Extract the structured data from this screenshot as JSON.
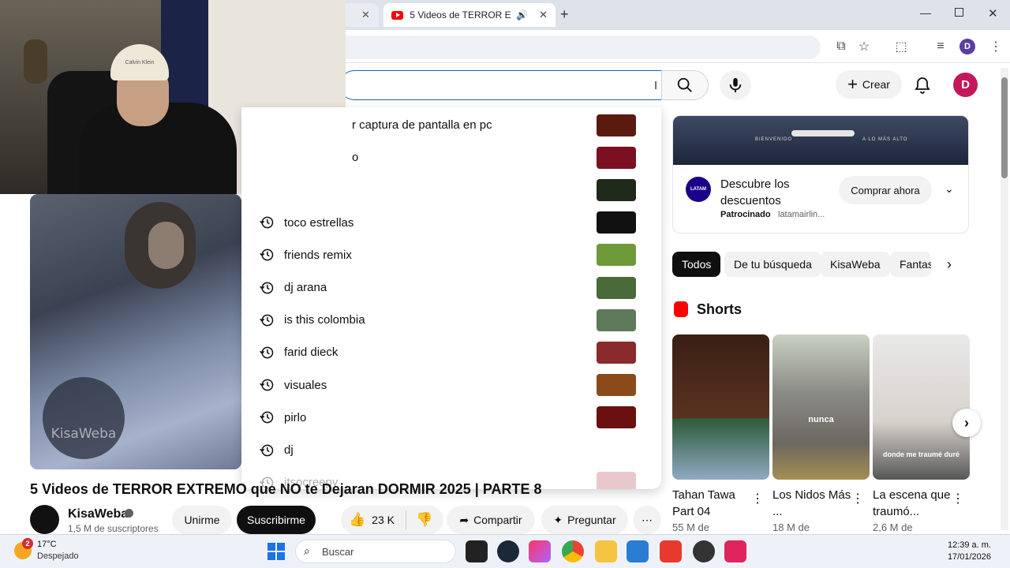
{
  "browser": {
    "tabs": [
      {
        "label": "5 Videos de TERROR EXTRE"
      }
    ],
    "new_tab": "+",
    "profile_initial": "D",
    "window_controls": [
      "minimize-icon",
      "restore-icon",
      "close-icon"
    ]
  },
  "yt_header": {
    "search_value": "",
    "create_label": "Crear",
    "avatar_initial": "D"
  },
  "suggestions": [
    {
      "text": "r captura de pantalla en pc",
      "thumb": "#5b1a10"
    },
    {
      "text": "o",
      "thumb": "#7a1020"
    },
    {
      "text": "",
      "thumb": "#1f2a1a"
    },
    {
      "text": "toco estrellas",
      "thumb": "#111111"
    },
    {
      "text": "friends remix",
      "thumb": "#6f9a3a"
    },
    {
      "text": "dj arana",
      "thumb": "#4a6a3a"
    },
    {
      "text": "is this colombia",
      "thumb": "#5e7a5a"
    },
    {
      "text": "farid dieck",
      "thumb": "#8a2a2a"
    },
    {
      "text": "visuales",
      "thumb": "#8a4a1a"
    },
    {
      "text": "pirlo",
      "thumb": "#6a1010"
    },
    {
      "text": "dj",
      "thumb": ""
    },
    {
      "text": "itsocreepy",
      "thumb": "#c06070"
    }
  ],
  "video": {
    "title": "5 Videos de TERROR EXTREMO que NO te Dejaran DORMIR 2025 | PARTE 8",
    "watermark": "KisaWeba",
    "channel": "KisaWeba",
    "subscribers": "1,5 M de suscriptores",
    "join_label": "Unirme",
    "subscribe_label": "Suscribirme",
    "likes": "23 K",
    "share_label": "Compartir",
    "ask_label": "Preguntar"
  },
  "ad": {
    "banner_text_left": "BIENVENIDO",
    "banner_text_right": "A LO MÁS ALTO",
    "brand_logo": "LATAM",
    "headline": "Descubre los descuentos",
    "sponsored": "Patrocinado",
    "domain": "latamairlin...",
    "cta": "Comprar ahora"
  },
  "chips": [
    "Todos",
    "De tu búsqueda",
    "KisaWeba",
    "Fantas"
  ],
  "shorts": {
    "heading": "Shorts",
    "items": [
      {
        "title": "Tahan Tawa Part 04",
        "views": "55 M de",
        "overlay": ""
      },
      {
        "title": "Los Nidos Más ...",
        "views": "18 M de",
        "overlay": "nunca"
      },
      {
        "title": "La escena que traumó...",
        "views": "2,6 M de",
        "overlay": "donde me traumé duré"
      }
    ]
  },
  "webcam": {
    "cap_text": "Calvin Klein"
  },
  "taskbar": {
    "weather_temp": "17°C",
    "weather_desc": "Despejado",
    "weather_badge": "2",
    "search_placeholder": "Buscar",
    "time": "12:39 a. m.",
    "date": "17/01/2026"
  },
  "colors": {
    "yt_red": "#ff0000",
    "avatar": "#c2185b",
    "search_border": "#1c62b9",
    "subscribe_bg": "#0f0f0f"
  }
}
